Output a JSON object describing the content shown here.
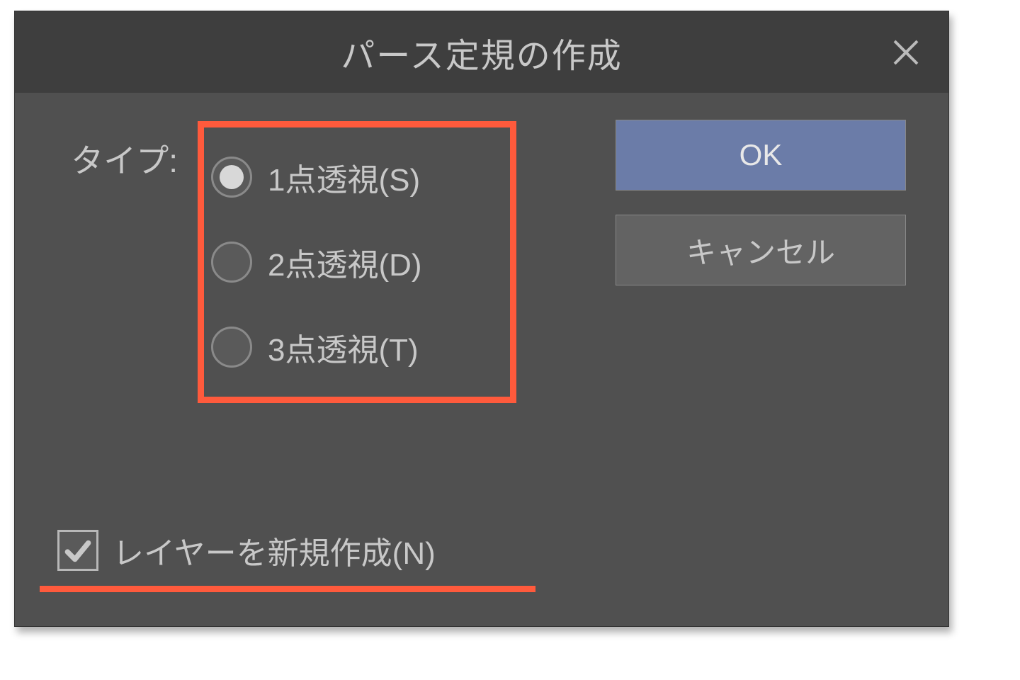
{
  "dialog": {
    "title": "パース定規の作成",
    "type_label": "タイプ:",
    "radios": [
      {
        "label": "1点透視(S)",
        "selected": true
      },
      {
        "label": "2点透視(D)",
        "selected": false
      },
      {
        "label": "3点透視(T)",
        "selected": false
      }
    ],
    "ok_label": "OK",
    "cancel_label": "キャンセル",
    "checkbox": {
      "label": "レイヤーを新規作成(N)",
      "checked": true
    }
  }
}
